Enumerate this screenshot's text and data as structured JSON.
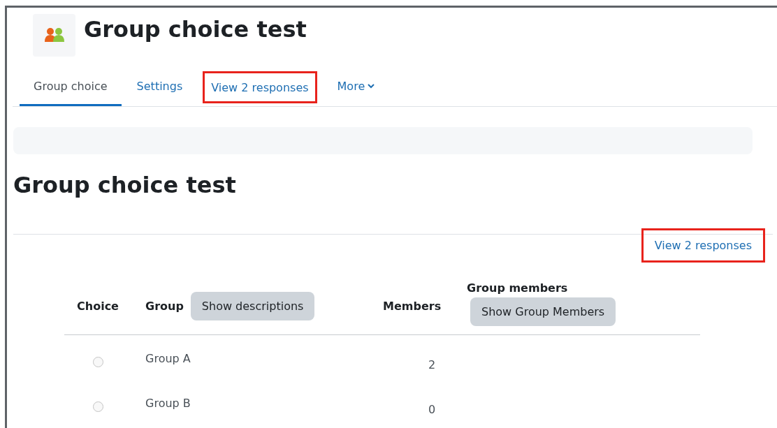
{
  "header": {
    "title": "Group choice test"
  },
  "tabs": [
    {
      "label": "Group choice",
      "selected": true,
      "highlighted": false,
      "has_caret": false
    },
    {
      "label": "Settings",
      "selected": false,
      "highlighted": false,
      "has_caret": false
    },
    {
      "label": "View 2 responses",
      "selected": false,
      "highlighted": true,
      "has_caret": false
    },
    {
      "label": "More",
      "selected": false,
      "highlighted": false,
      "has_caret": true
    }
  ],
  "heading": "Group choice test",
  "responses_link": {
    "label": "View 2 responses",
    "highlighted": true
  },
  "table": {
    "columns": [
      {
        "label": "Choice"
      },
      {
        "label": "Group",
        "button": "Show descriptions"
      },
      {
        "label": "Members"
      },
      {
        "label": "Group members",
        "button": "Show Group Members"
      }
    ],
    "rows": [
      {
        "selected": false,
        "group": "Group A",
        "members": "2"
      },
      {
        "selected": false,
        "group": "Group B",
        "members": "0"
      }
    ]
  }
}
